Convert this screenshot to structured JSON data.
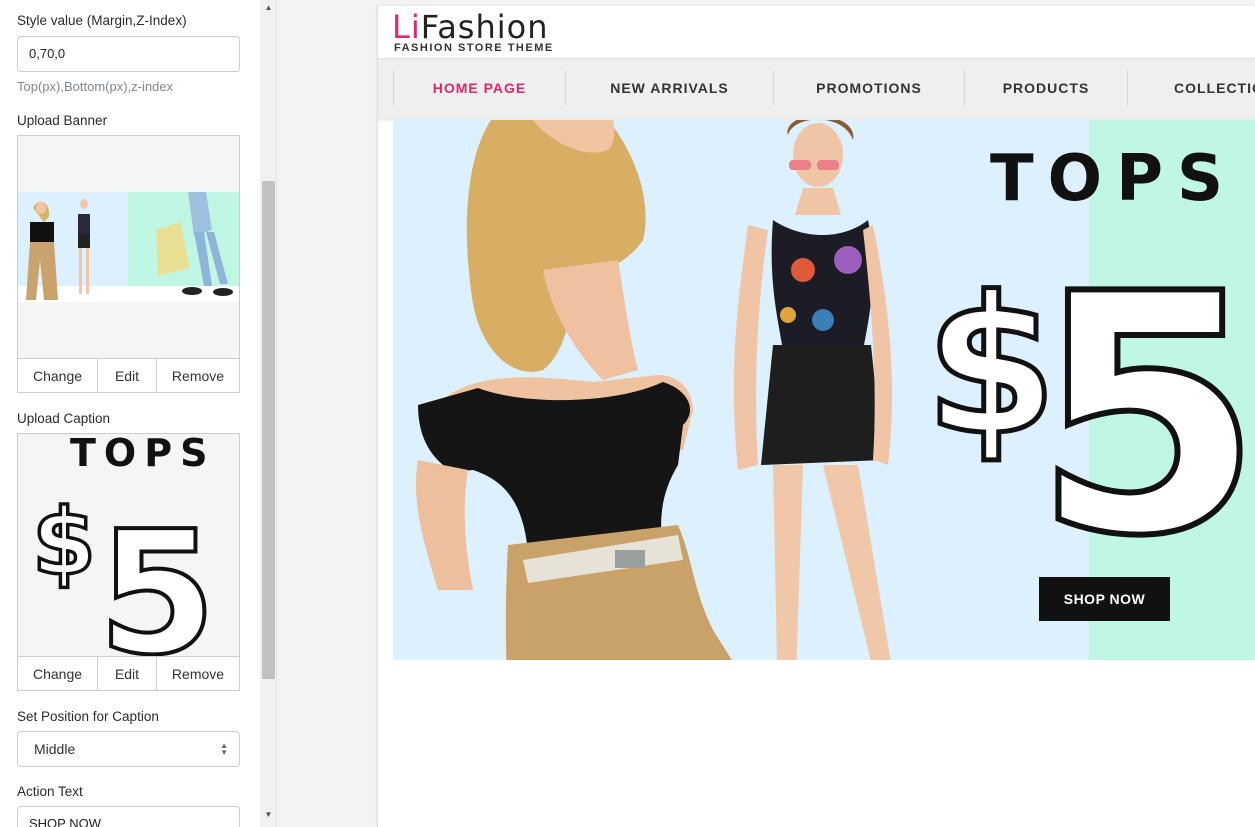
{
  "sidebar": {
    "style_value": {
      "label": "Style value (Margin,Z-Index)",
      "value": "0,70,0",
      "hint": "Top(px),Bottom(px),z-index"
    },
    "upload_banner": {
      "label": "Upload Banner",
      "buttons": [
        "Change",
        "Edit",
        "Remove"
      ]
    },
    "upload_caption": {
      "label": "Upload Caption",
      "caption_title": "TOPS",
      "caption_price": "$5",
      "buttons": [
        "Change",
        "Edit",
        "Remove"
      ]
    },
    "caption_position": {
      "label": "Set Position for Caption",
      "selected": "Middle"
    },
    "action_text": {
      "label": "Action Text",
      "value": "SHOP NOW"
    }
  },
  "preview": {
    "logo_prefix": "Li",
    "logo_main": "Fashion",
    "tagline": "FASHION STORE THEME",
    "nav": [
      "HOME PAGE",
      "NEW ARRIVALS",
      "PROMOTIONS",
      "PRODUCTS",
      "COLLECTIO"
    ],
    "hero": {
      "title": "TOPS",
      "price": "$5",
      "button": "SHOP NOW"
    }
  },
  "colors": {
    "accent": "#e3266a",
    "hero_blue": "#dcf0fd",
    "hero_mint": "#c0f7e4",
    "button_dark": "#111111"
  }
}
